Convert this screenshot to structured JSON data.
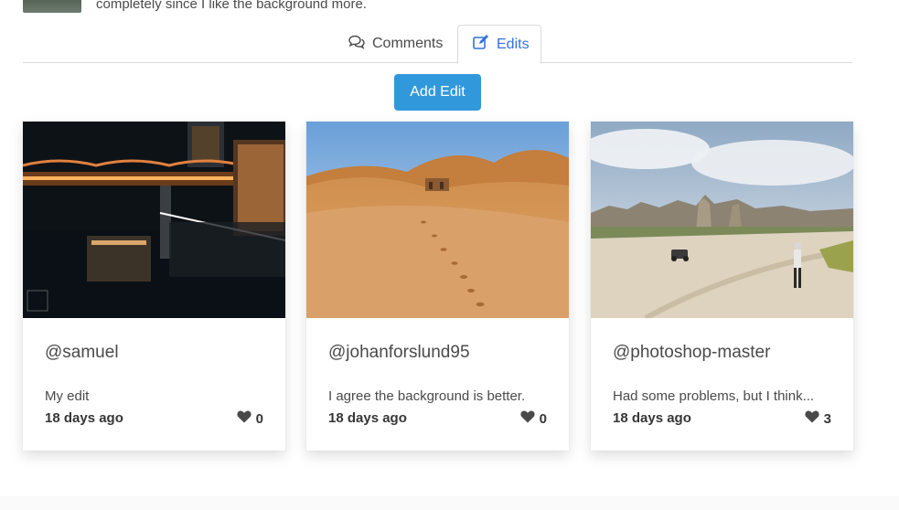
{
  "top": {
    "text": "completely since I like the background more."
  },
  "tabs": [
    {
      "label": "Comments",
      "icon": "comments-icon"
    },
    {
      "label": "Edits",
      "icon": "edit-icon"
    }
  ],
  "add_edit_label": "Add Edit",
  "cards": [
    {
      "user": "@samuel",
      "text": "My edit",
      "date": "18 days ago",
      "likes": "0"
    },
    {
      "user": "@johanforslund95",
      "text": "I agree the background is better.",
      "date": "18 days ago",
      "likes": "0"
    },
    {
      "user": "@photoshop-master",
      "text": "Had some problems, but I think...",
      "date": "18 days ago",
      "likes": "3"
    }
  ],
  "colors": {
    "accent": "#3273dc",
    "button": "#3298dc",
    "text": "#4a4a4a"
  }
}
